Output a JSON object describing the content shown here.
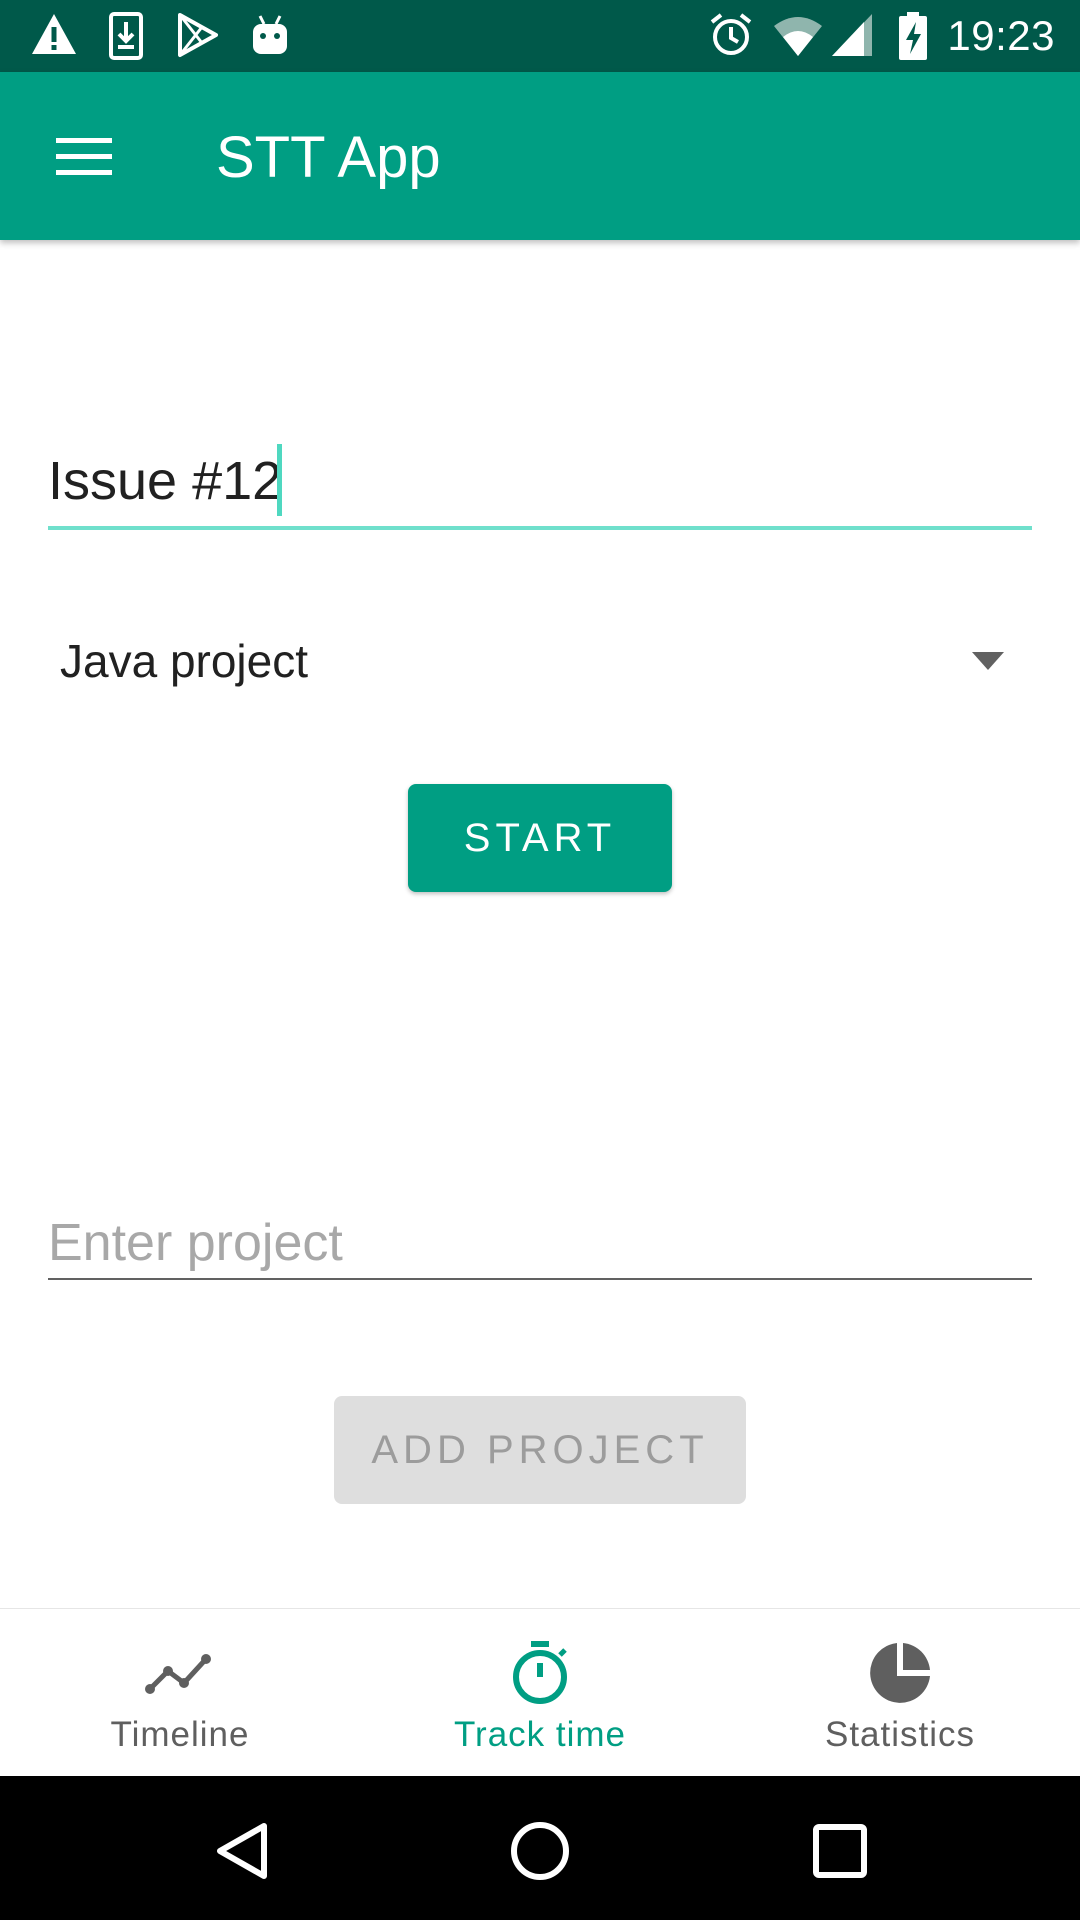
{
  "status_bar": {
    "time": "19:23",
    "left_icons": [
      "warning-icon",
      "download-icon",
      "play-store-icon",
      "android-icon"
    ],
    "right_icons": [
      "alarm-icon",
      "wifi-icon",
      "signal-icon",
      "battery-charging-icon"
    ]
  },
  "app_bar": {
    "title": "STT App",
    "menu_icon": "menu-icon"
  },
  "form": {
    "issue_value": "Issue #12",
    "project_selected": "Java project",
    "start_label": "START",
    "project_placeholder": "Enter project",
    "add_project_label": "ADD PROJECT"
  },
  "bottom_nav": {
    "items": [
      {
        "label": "Timeline",
        "icon": "timeline-icon",
        "active": false
      },
      {
        "label": "Track time",
        "icon": "stopwatch-icon",
        "active": true
      },
      {
        "label": "Statistics",
        "icon": "pie-chart-icon",
        "active": false
      }
    ]
  },
  "system_nav": [
    "back-icon",
    "home-icon",
    "recents-icon"
  ],
  "colors": {
    "primary": "#009e83",
    "primary_dark": "#00594a",
    "accent": "#6fe0cc",
    "disabled_bg": "#dedede"
  }
}
